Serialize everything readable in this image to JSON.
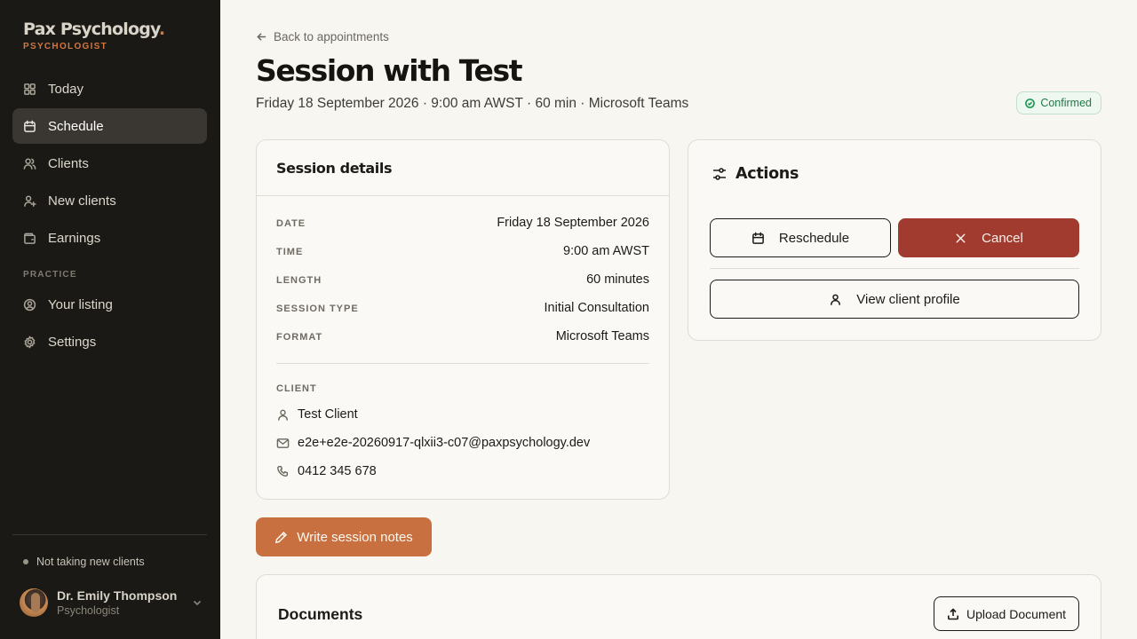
{
  "brand": {
    "name": "Pax Psychology",
    "dot": ".",
    "role": "PSYCHOLOGIST"
  },
  "nav": {
    "items": [
      {
        "label": "Today",
        "icon": "grid-icon"
      },
      {
        "label": "Schedule",
        "icon": "calendar-icon",
        "active": true
      },
      {
        "label": "Clients",
        "icon": "users-icon"
      },
      {
        "label": "New clients",
        "icon": "user-plus-icon"
      },
      {
        "label": "Earnings",
        "icon": "wallet-icon"
      }
    ],
    "section_label": "PRACTICE",
    "practice_items": [
      {
        "label": "Your listing",
        "icon": "user-circle-icon"
      },
      {
        "label": "Settings",
        "icon": "gear-icon"
      }
    ]
  },
  "availability": "Not taking new clients",
  "user": {
    "name": "Dr. Emily Thompson",
    "role": "Psychologist"
  },
  "header": {
    "back_label": "Back to appointments",
    "title": "Session with Test",
    "subtitle": "Friday 18 September 2026 · 9:00 am AWST · 60 min · Microsoft Teams",
    "status": "Confirmed"
  },
  "details": {
    "title": "Session details",
    "rows": [
      {
        "label": "DATE",
        "value": "Friday 18 September 2026"
      },
      {
        "label": "TIME",
        "value": "9:00 am AWST"
      },
      {
        "label": "LENGTH",
        "value": "60 minutes"
      },
      {
        "label": "SESSION TYPE",
        "value": "Initial Consultation"
      },
      {
        "label": "FORMAT",
        "value": "Microsoft Teams"
      }
    ],
    "client_label": "CLIENT",
    "client": {
      "name": "Test Client",
      "email": "e2e+e2e-20260917-qlxii3-c07@paxpsychology.dev",
      "phone": "0412 345 678"
    }
  },
  "actions": {
    "title": "Actions",
    "reschedule": "Reschedule",
    "cancel": "Cancel",
    "view_profile": "View client profile"
  },
  "notes_button": "Write session notes",
  "documents": {
    "title": "Documents",
    "upload": "Upload Document"
  },
  "colors": {
    "accent": "#c8703f",
    "danger": "#a13a2f",
    "sidebar": "#1b1915",
    "success": "#1f7a45"
  }
}
